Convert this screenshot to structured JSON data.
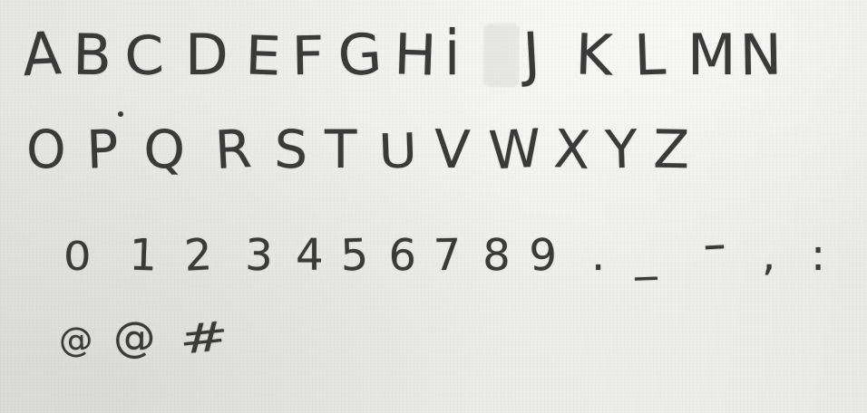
{
  "rows": [
    {
      "name": "uppercase-a-n",
      "chars": [
        "A",
        "B",
        "C",
        "D",
        "E",
        "F",
        "G",
        "H",
        "i",
        "J",
        "K",
        "L",
        "M",
        "N"
      ]
    },
    {
      "name": "uppercase-o-z",
      "chars": [
        "O",
        "P",
        "Q",
        "R",
        "S",
        "T",
        "U",
        "V",
        "W",
        "X",
        "Y",
        "Z"
      ]
    },
    {
      "name": "digits-and-punctuation",
      "chars": [
        "0",
        "1",
        "2",
        "3",
        "4",
        "5",
        "6",
        "7",
        "8",
        "9",
        ".",
        "_",
        "-",
        ",",
        ":"
      ]
    },
    {
      "name": "symbols",
      "chars": [
        "@",
        "@",
        "#"
      ]
    }
  ]
}
